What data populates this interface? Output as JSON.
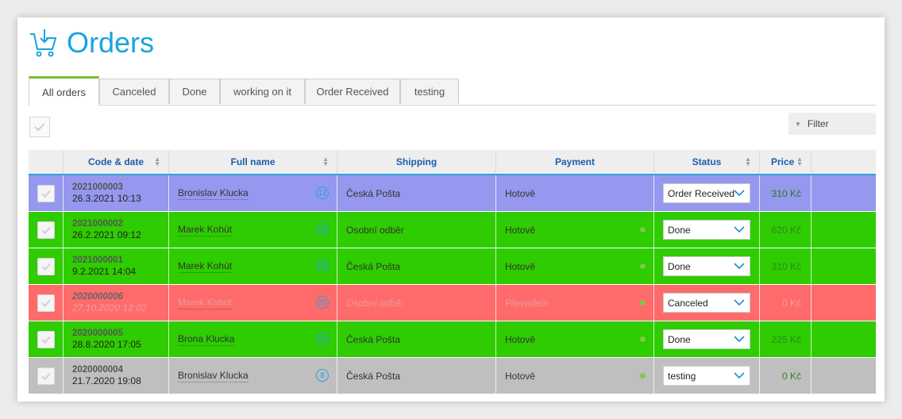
{
  "page": {
    "title": "Orders",
    "accent": "#1aa3e0"
  },
  "tabs": [
    {
      "label": "All orders",
      "active": true
    },
    {
      "label": "Canceled"
    },
    {
      "label": "Done"
    },
    {
      "label": "working on it"
    },
    {
      "label": "Order Received"
    },
    {
      "label": "testing"
    }
  ],
  "toolbar": {
    "filter_label": "Filter"
  },
  "columns": {
    "code_date": "Code & date",
    "full_name": "Full name",
    "shipping": "Shipping",
    "payment": "Payment",
    "status": "Status",
    "price": "Price"
  },
  "rows": [
    {
      "code": "2021000003",
      "date": "26.3.2021 10:13",
      "name": "Bronislav Klucka",
      "badge": "12",
      "shipping": "Česká Pošta",
      "payment": "Hotově",
      "status": "Order Received",
      "price": "310 Kč",
      "bg": "#9598ee",
      "dot": false
    },
    {
      "code": "2021000002",
      "date": "26.2.2021 09:12",
      "name": "Marek Kohút",
      "badge": "19",
      "shipping": "Osobní odběr",
      "payment": "Hotově",
      "status": "Done",
      "price": "620 Kč",
      "bg": "#2ecc00",
      "dot": true
    },
    {
      "code": "2021000001",
      "date": "9.2.2021 14:04",
      "name": "Marek Kohút",
      "badge": "20",
      "shipping": "Česká Pošta",
      "payment": "Hotově",
      "status": "Done",
      "price": "310 Kč",
      "bg": "#2ecc00",
      "dot": true
    },
    {
      "code": "2020000006",
      "date": "27.10.2020 12:02",
      "name": "Marek Kohút",
      "badge": "20",
      "shipping": "Osobní odběr",
      "payment": "Převodem",
      "status": "Canceled",
      "price": "0 Kč",
      "bg": "#ff6b6b",
      "dot": true,
      "canceled": true
    },
    {
      "code": "2020000005",
      "date": "28.8.2020 17:05",
      "name": "Brona Klucka",
      "badge": "21",
      "shipping": "Česká Pošta",
      "payment": "Hotově",
      "status": "Done",
      "price": "225 Kč",
      "bg": "#2ecc00",
      "dot": true
    },
    {
      "code": "2020000004",
      "date": "21.7.2020 19:08",
      "name": "Bronislav Klucka",
      "badge": "8",
      "shipping": "Česká Pošta",
      "payment": "Hotově",
      "status": "testing",
      "price": "0 Kč",
      "bg": "#bfbfbf",
      "dot": true
    }
  ]
}
